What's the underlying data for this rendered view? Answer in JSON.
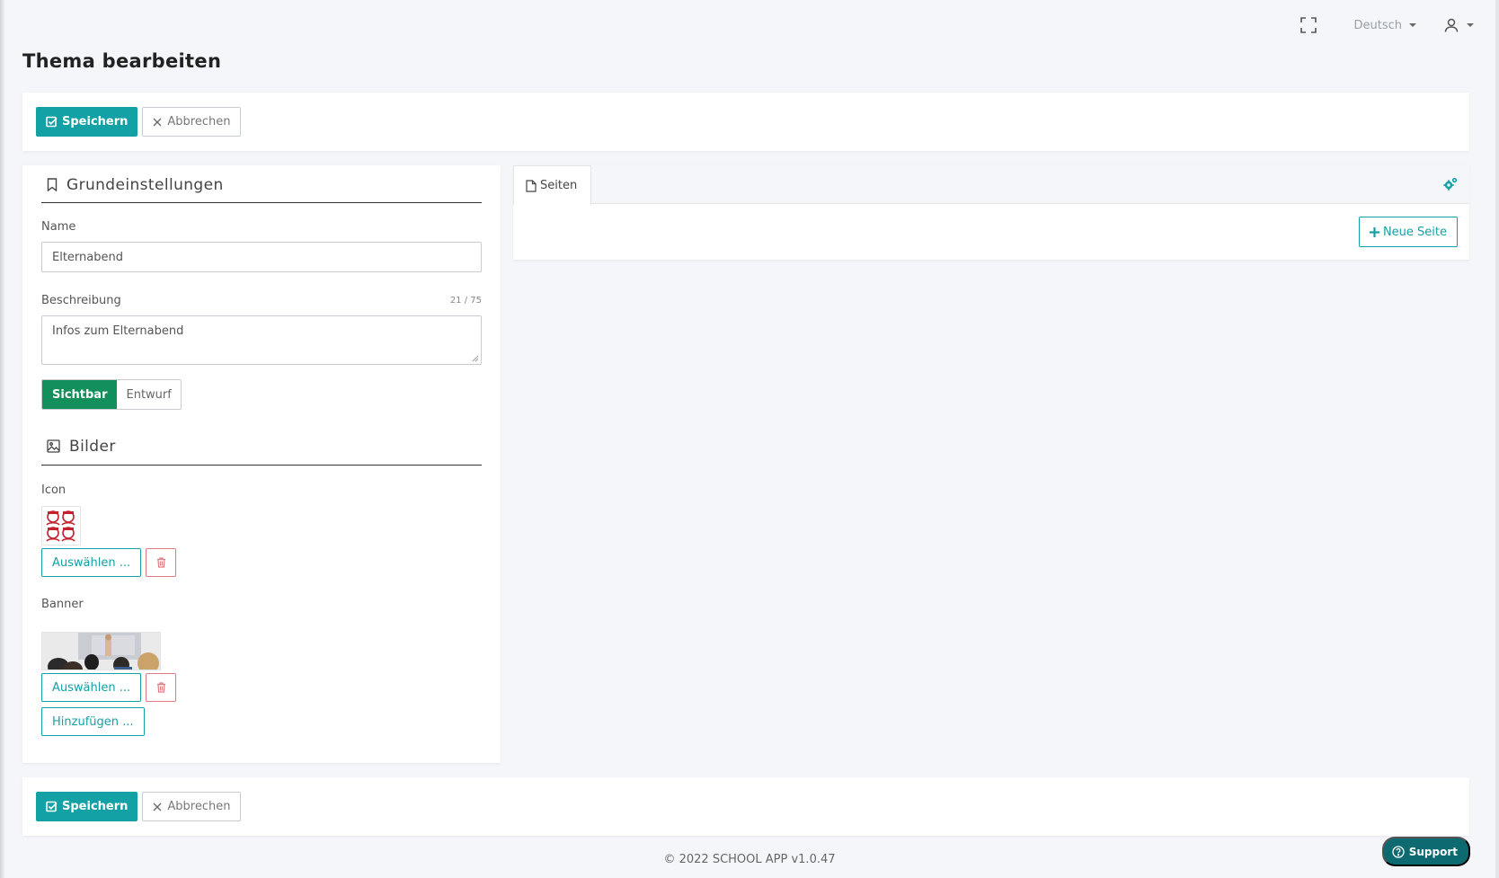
{
  "header": {
    "language": "Deutsch",
    "page_title": "Thema bearbeiten"
  },
  "actions": {
    "save_label": "Speichern",
    "cancel_label": "Abbrechen"
  },
  "form": {
    "section_basic": "Grundeinstellungen",
    "name_label": "Name",
    "name_value": "Elternabend",
    "description_label": "Beschreibung",
    "description_counter": "21 / 75",
    "description_value": "Infos zum Elternabend",
    "visibility_on": "Sichtbar",
    "visibility_off": "Entwurf",
    "section_images": "Bilder",
    "icon_label": "Icon",
    "banner_label": "Banner",
    "select_label": "Auswählen ...",
    "add_label": "Hinzufügen ..."
  },
  "pages_panel": {
    "tab_label": "Seiten",
    "new_page_label": "Neue Seite"
  },
  "footer": {
    "copyright": "© 2022 SCHOOL APP v1.0.47",
    "support_label": "Support"
  },
  "colors": {
    "primary": "#14a1a6",
    "visible_toggle": "#138f5b",
    "danger": "#e07b82",
    "support": "#0d6a70"
  }
}
